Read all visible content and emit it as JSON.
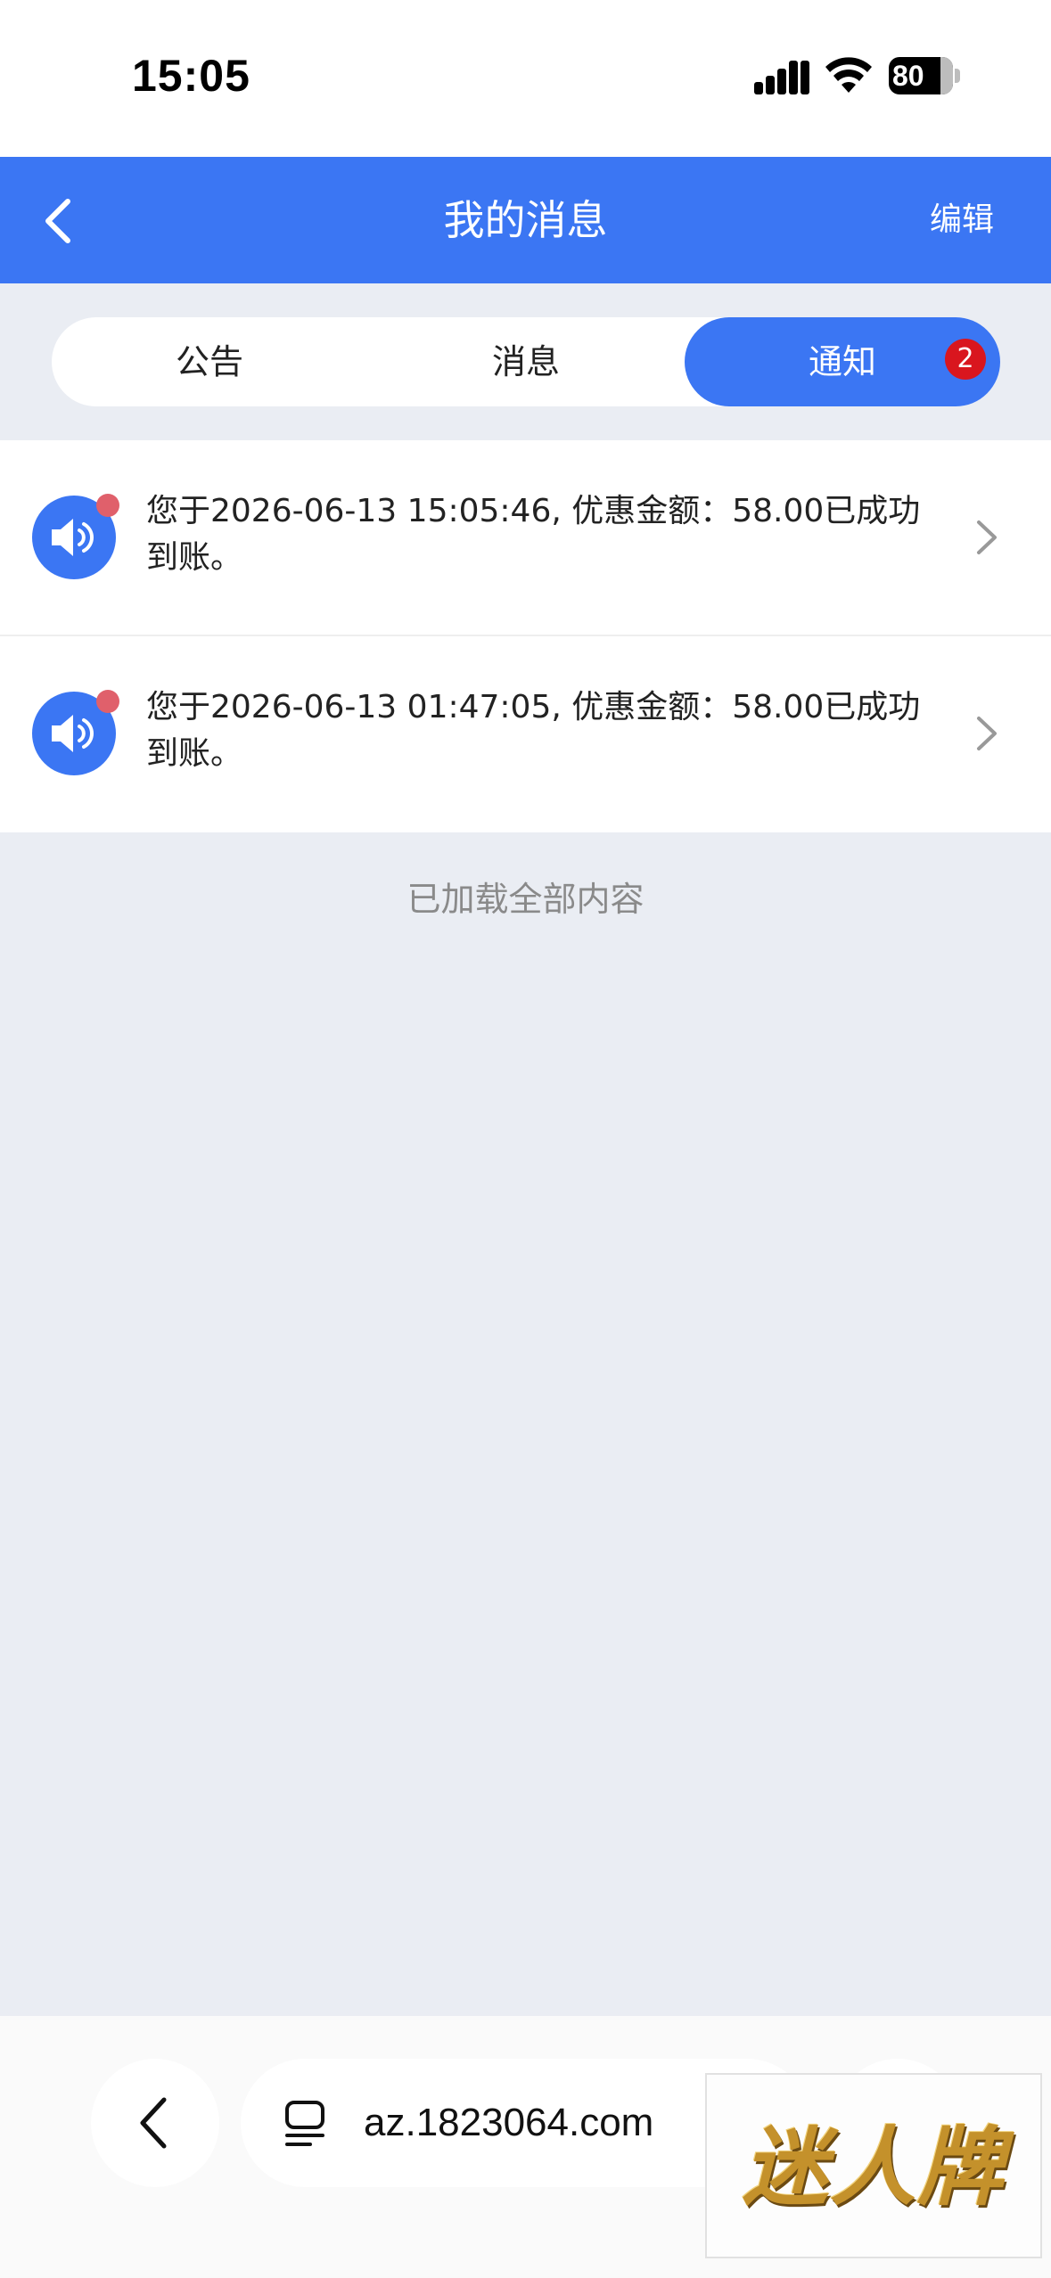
{
  "status_bar": {
    "time": "15:05",
    "battery": "80"
  },
  "nav": {
    "title": "我的消息",
    "edit_label": "编辑"
  },
  "segment": {
    "tabs": [
      {
        "label": "公告"
      },
      {
        "label": "消息"
      },
      {
        "label": "通知",
        "badge": "2",
        "active": true
      }
    ]
  },
  "notifications": [
    {
      "text": "您于2026-06-13 15:05:46, 优惠金额：58.00已成功到账。",
      "unread": true
    },
    {
      "text": "您于2026-06-13 01:47:05, 优惠金额：58.00已成功到账。",
      "unread": true
    }
  ],
  "list_footer": "已加载全部内容",
  "browser": {
    "url": "az.1823064.com"
  },
  "watermark": "迷人牌",
  "colors": {
    "primary": "#3b76f3",
    "badge": "#d9161e",
    "unread_dot": "#e0606b",
    "page_background": "#eaedf3"
  }
}
